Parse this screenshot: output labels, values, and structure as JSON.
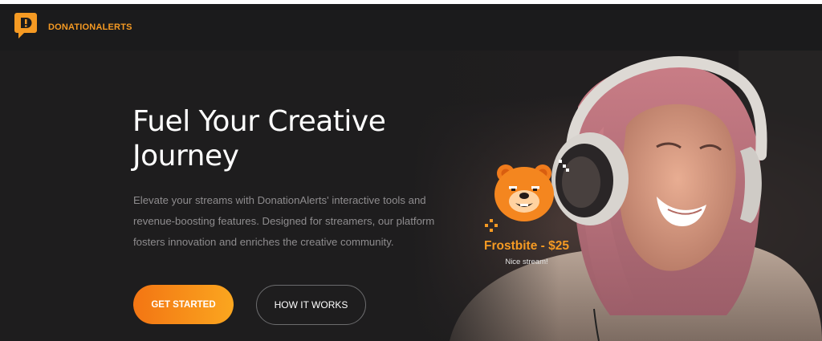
{
  "header": {
    "brand_name": "DONATIONALERTS",
    "logo_icon": "donationalerts-logo-icon",
    "accent_color": "#f59a23",
    "background_color": "#1b1b1c"
  },
  "hero": {
    "headline": "Fuel Your Creative Journey",
    "lead": "Elevate your streams with DonationAlerts' interactive tools and revenue-boosting features. Designed for streamers, our platform fosters innovation and enriches the creative community.",
    "primary_button": "GET STARTED",
    "secondary_button": "HOW IT WORKS",
    "background_color": "#1e1d1e",
    "button_gradient": [
      "#f37513",
      "#fba61f"
    ]
  },
  "alert_widget": {
    "avatar_icon": "bear-mascot-icon",
    "title": "Frostbite - $25",
    "message": "Nice stream!"
  }
}
